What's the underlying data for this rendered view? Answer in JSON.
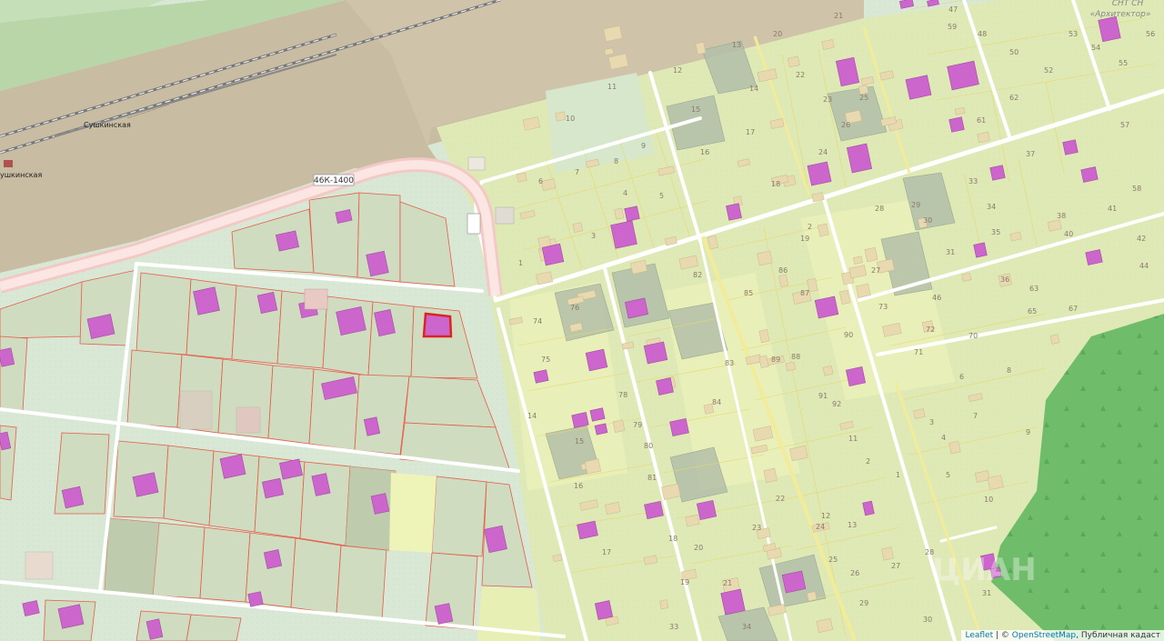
{
  "map": {
    "road_shield": "46К-1400",
    "station_name": "Сушкинская",
    "station_name_cut": "ушкинская",
    "snt_title_line1": "СНТ СН",
    "snt_title_line2": "«Архитектор»",
    "watermark": "ЦИАН"
  },
  "attribution": {
    "leaflet": "Leaflet",
    "sep1": " | © ",
    "osm": "OpenStreetMap",
    "rest": ", Публичная кадаст"
  },
  "colors": {
    "background": "#d9e8d4",
    "railway_zone": "#c8bca2",
    "snt_zone": "#e4ecb0",
    "forest": "#6fbd6a",
    "building": "#cc66cc",
    "selected_parcel": "#dd2222",
    "parcel_outline": "#e65b4b",
    "road": "#ffffff"
  },
  "plot_numbers": [
    "6",
    "7",
    "8",
    "9",
    "5",
    "4",
    "3",
    "1",
    "2",
    "10",
    "11",
    "12",
    "13",
    "14",
    "15",
    "16",
    "17",
    "18",
    "19",
    "20",
    "21",
    "22",
    "23",
    "24",
    "25",
    "26",
    "27",
    "28",
    "29",
    "30",
    "31",
    "33",
    "34",
    "35",
    "36",
    "37",
    "38",
    "40",
    "41",
    "42",
    "44",
    "46",
    "47",
    "48",
    "50",
    "52",
    "53",
    "54",
    "55",
    "56",
    "57",
    "58",
    "59",
    "61",
    "62",
    "63",
    "65",
    "67",
    "70",
    "71",
    "72",
    "73",
    "74",
    "75",
    "76",
    "78",
    "79",
    "80",
    "81",
    "82",
    "83",
    "84",
    "85",
    "86",
    "87",
    "88",
    "89",
    "90",
    "91",
    "92"
  ]
}
